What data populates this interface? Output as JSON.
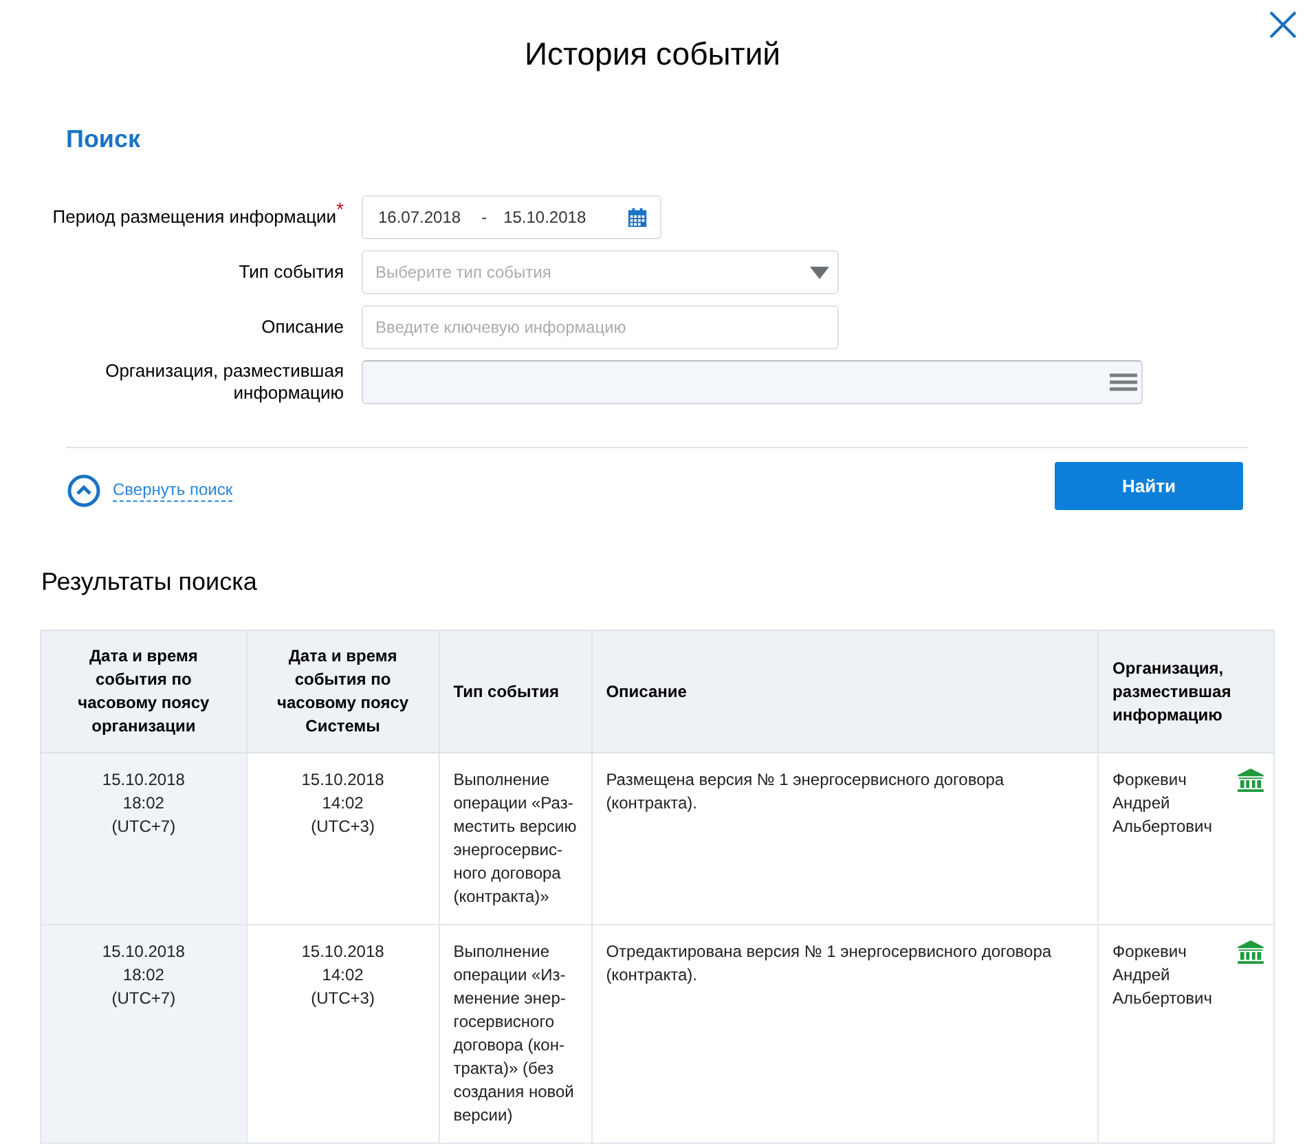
{
  "dialog": {
    "title": "История событий"
  },
  "search": {
    "title": "Поиск",
    "fields": [
      {
        "kind": "daterange",
        "label": "Период размещения информации",
        "required_mark": "*",
        "from": "16.07.2018",
        "separator": "-",
        "to": "15.10.2018"
      },
      {
        "kind": "select",
        "label": "Тип события",
        "placeholder": "Выберите тип события"
      },
      {
        "kind": "text",
        "label": "Описание",
        "placeholder": "Введите ключевую информацию"
      },
      {
        "kind": "list",
        "label": "Организация, разместившая\nинформацию"
      }
    ],
    "collapse_link": "Свернуть поиск",
    "submit_button": "Найти"
  },
  "results": {
    "title": "Результаты поиска",
    "table": {
      "columns": [
        "Дата и время\nсобытия по\nчасовому поясу\nорганизации",
        "Дата и время\nсобытия по\nчасовому поясу\nСистемы",
        "Тип события",
        "Описание",
        "Организация,\nразместившая\nинформацию"
      ],
      "rows": [
        {
          "org_time": "15.10.2018\n18:02\n(UTC+7)",
          "system_time": "15.10.2018\n14:02\n(UTC+3)",
          "event_type": "Выполнение\nоперации «Раз-\nместить версию\nэнергосервис-\nного договора\n(контракта)»",
          "description": "Размещена версия № 1 энергосервисного договора (контракта).",
          "organization": "Форкевич\nАндрей\nАльбертович"
        },
        {
          "org_time": "15.10.2018\n18:02\n(UTC+7)",
          "system_time": "15.10.2018\n14:02\n(UTC+3)",
          "event_type": "Выполнение\nоперации «Из-\nменение энер-\nгосервисного\nдоговора (кон-\nтракта)» (без\nсоздания новой\nверсии)",
          "description": "Отредактирована версия № 1 энергосервисного договора (контракта).",
          "organization": "Форкевич\nАндрей\nАльбертович"
        }
      ]
    }
  }
}
